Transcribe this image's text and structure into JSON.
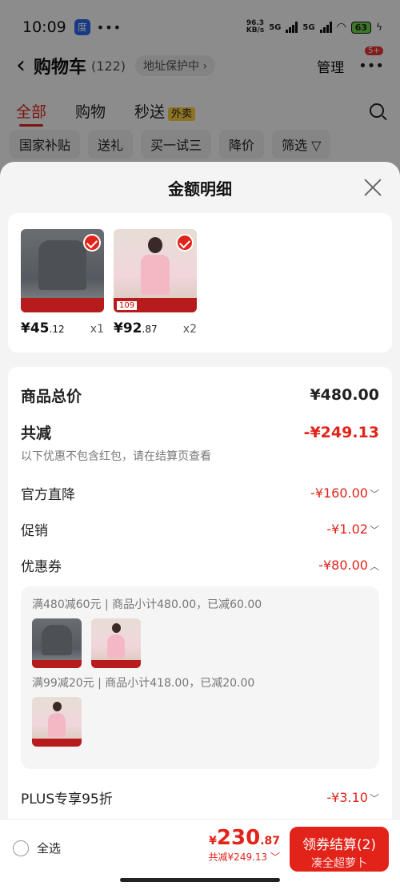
{
  "status": {
    "time": "10:09",
    "net_speed_top": "96.3",
    "net_speed_bottom": "KB/s",
    "sig1": "5G",
    "sig2": "5G",
    "battery": "63"
  },
  "nav": {
    "title": "购物车",
    "count": "(122)",
    "address_pill": "地址保护中 ›",
    "manage": "管理",
    "more_badge": "5+"
  },
  "tabs": [
    {
      "label": "全部"
    },
    {
      "label": "购物"
    },
    {
      "label": "秒送"
    }
  ],
  "waimai_badge": "外卖",
  "chips": [
    {
      "label": "国家补贴"
    },
    {
      "label": "送礼"
    },
    {
      "label": "买一试三"
    },
    {
      "label": "降价"
    },
    {
      "label": "筛选 ▽"
    }
  ],
  "sheet": {
    "title": "金额明细",
    "products": [
      {
        "price_int": "¥45",
        "price_dec": ".12",
        "qty": "x1",
        "kind": "sweater"
      },
      {
        "price_int": "¥92",
        "price_dec": ".87",
        "qty": "x2",
        "kind": "dress",
        "strip_price": "109"
      }
    ],
    "total_label": "商品总价",
    "total_value": "¥480.00",
    "reduce_label": "共减",
    "reduce_value": "-¥249.13",
    "note": "以下优惠不包含红包，请在结算页查看",
    "items": [
      {
        "label": "官方直降",
        "value": "-¥160.00",
        "chev": "﹀"
      },
      {
        "label": "促销",
        "value": "-¥1.02",
        "chev": "﹀"
      },
      {
        "label": "优惠券",
        "value": "-¥80.00",
        "chev": "︿"
      }
    ],
    "coupons": [
      {
        "text": "满480减60元 | 商品小计480.00，已减60.00"
      },
      {
        "text": "满99减20元 | 商品小计418.00，已减20.00"
      }
    ],
    "plus_label": "PLUS专享95折",
    "plus_value": "-¥3.10",
    "plus_chev": "﹀"
  },
  "bottom": {
    "select_all": "全选",
    "yen": "¥",
    "total_int": "230",
    "total_dec": ".87",
    "total_sub": "共减¥249.13 ﹀",
    "checkout": "领券结算(2)",
    "checkout_sub": "凑全超萝卜"
  }
}
